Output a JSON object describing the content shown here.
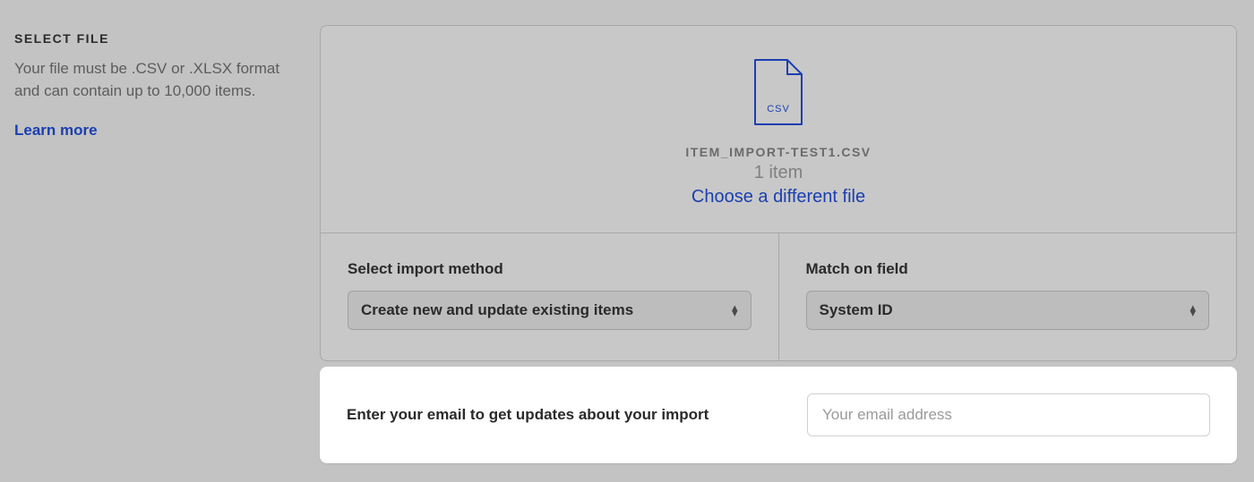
{
  "sidebar": {
    "title": "SELECT FILE",
    "description": "Your file must be .CSV or .XLSX format and can contain up to 10,000 items.",
    "learn_more": "Learn more"
  },
  "file": {
    "icon_label": "CSV",
    "name": "ITEM_IMPORT-TEST1.CSV",
    "item_count": "1 item",
    "choose_different": "Choose a different file"
  },
  "options": {
    "import_method": {
      "label": "Select import method",
      "value": "Create new and update existing items"
    },
    "match_field": {
      "label": "Match on field",
      "value": "System ID"
    }
  },
  "email": {
    "label": "Enter your email to get updates about your import",
    "placeholder": "Your email address"
  },
  "colors": {
    "link": "#1a3fb0",
    "muted_bg": "#c3c3c3"
  }
}
